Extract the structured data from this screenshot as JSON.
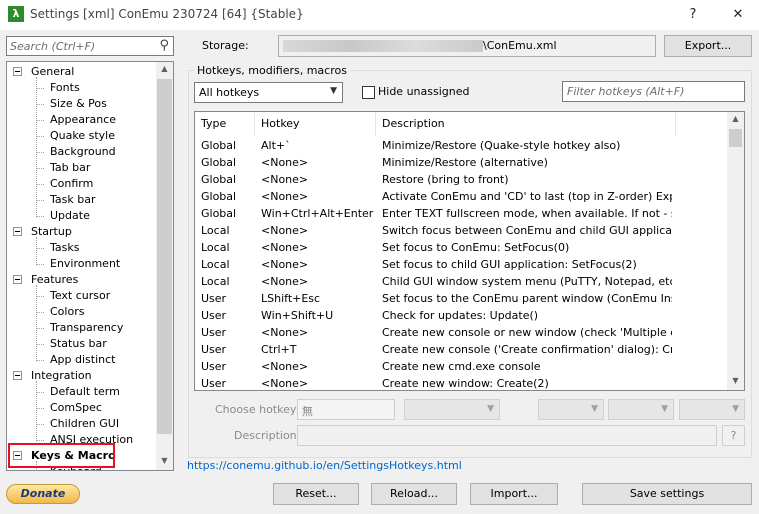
{
  "window": {
    "title": "Settings [xml] ConEmu 230724 [64] {Stable}",
    "app_icon_glyph": "λ",
    "help_glyph": "?",
    "close_glyph": "✕"
  },
  "sidebar": {
    "search_placeholder": "Search (Ctrl+F)",
    "tree": [
      {
        "label": "General",
        "level": 0
      },
      {
        "label": "Fonts",
        "level": 1
      },
      {
        "label": "Size & Pos",
        "level": 1
      },
      {
        "label": "Appearance",
        "level": 1
      },
      {
        "label": "Quake style",
        "level": 1
      },
      {
        "label": "Background",
        "level": 1
      },
      {
        "label": "Tab bar",
        "level": 1
      },
      {
        "label": "Confirm",
        "level": 1
      },
      {
        "label": "Task bar",
        "level": 1
      },
      {
        "label": "Update",
        "level": 1
      },
      {
        "label": "Startup",
        "level": 0
      },
      {
        "label": "Tasks",
        "level": 1
      },
      {
        "label": "Environment",
        "level": 1
      },
      {
        "label": "Features",
        "level": 0
      },
      {
        "label": "Text cursor",
        "level": 1
      },
      {
        "label": "Colors",
        "level": 1
      },
      {
        "label": "Transparency",
        "level": 1
      },
      {
        "label": "Status bar",
        "level": 1
      },
      {
        "label": "App distinct",
        "level": 1
      },
      {
        "label": "Integration",
        "level": 0
      },
      {
        "label": "Default term",
        "level": 1
      },
      {
        "label": "ComSpec",
        "level": 1
      },
      {
        "label": "Children GUI",
        "level": 1
      },
      {
        "label": "ANSI execution",
        "level": 1
      },
      {
        "label": "Keys & Macro",
        "level": 0
      },
      {
        "label": "Keyboard",
        "level": 1
      }
    ],
    "selected": "Keys & Macro",
    "donate_label": "Donate"
  },
  "storage": {
    "label": "Storage:",
    "path_visible": "\\ConEmu.xml",
    "export_label": "Export..."
  },
  "hotkeys": {
    "group_title": "Hotkeys, modifiers, macros",
    "filter_combo_value": "All hotkeys",
    "hide_unassigned_label": "Hide unassigned",
    "filter_placeholder": "Filter hotkeys (Alt+F)",
    "columns": [
      "Type",
      "Hotkey",
      "Description"
    ],
    "rows": [
      [
        "Global",
        "Alt+`",
        "Minimize/Restore (Quake-style hotkey also)"
      ],
      [
        "Global",
        "<None>",
        "Minimize/Restore (alternative)"
      ],
      [
        "Global",
        "<None>",
        "Restore (bring to front)"
      ],
      [
        "Global",
        "<None>",
        "Activate ConEmu and 'CD' to last (top in Z-order) Explore..."
      ],
      [
        "Global",
        "Win+Ctrl+Alt+Enter",
        "Enter TEXT fullscreen mode, when available. If not - stan..."
      ],
      [
        "Local",
        "<None>",
        "Switch focus between ConEmu and child GUI application (..."
      ],
      [
        "Local",
        "<None>",
        "Set focus to ConEmu: SetFocus(0)"
      ],
      [
        "Local",
        "<None>",
        "Set focus to child GUI application: SetFocus(2)"
      ],
      [
        "Local",
        "<None>",
        "Child GUI window system menu (PuTTY, Notepad, etc.)"
      ],
      [
        "User",
        "LShift+Esc",
        "Set focus to the ConEmu parent window (ConEmu Inside ..."
      ],
      [
        "User",
        "Win+Shift+U",
        "Check for updates: Update()"
      ],
      [
        "User",
        "<None>",
        "Create new console or new window (check 'Multiple conso..."
      ],
      [
        "User",
        "Ctrl+T",
        "Create new console ('Create confirmation' dialog): Create..."
      ],
      [
        "User",
        "<None>",
        "Create new cmd.exe console"
      ],
      [
        "User",
        "<None>",
        "Create new window: Create(2)"
      ]
    ],
    "choose_hotkey_label": "Choose hotkey:",
    "choose_hotkey_value": "無",
    "description_label": "Description:",
    "desc_help": "?",
    "help_link": "https://conemu.github.io/en/SettingsHotkeys.html"
  },
  "footer": {
    "reset_label": "Reset...",
    "reload_label": "Reload...",
    "import_label": "Import...",
    "save_label": "Save settings"
  },
  "icons": {
    "search": "search-icon",
    "dropdown": "chevron-down-icon"
  }
}
